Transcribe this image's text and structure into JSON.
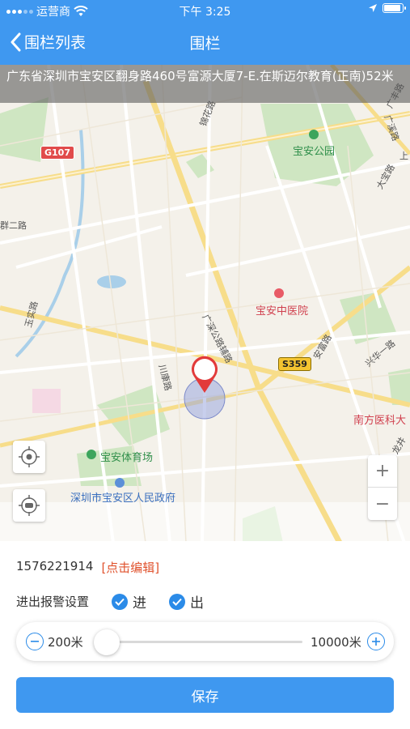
{
  "status_bar": {
    "carrier": "运营商",
    "time": "下午 3:25"
  },
  "nav": {
    "back_label": "围栏列表",
    "title": "围栏"
  },
  "map": {
    "address": "广东省深圳市宝安区翻身路460号富源大厦7-E.在斯迈尔教育(正南)52米",
    "labels": {
      "baoan_park": "宝安公园",
      "baoan_hospital": "宝安中医院",
      "stadium": "宝安体育场",
      "gov": "深圳市宝安区人民政府",
      "south_med": "南方医科大",
      "road_jinhua": "锦花路",
      "road_guangshen": "广深公路辅路",
      "road_chuankang": "川康路",
      "road_anfu": "安富路",
      "road_guangkuan": "广溪路",
      "road_dabao": "大宝路",
      "road_guangfeng": "广丰路",
      "road_qun": "群二路",
      "road_yu": "玉实路",
      "road_xing": "兴华一路",
      "road_long": "龙井",
      "road_shang": "上"
    },
    "road_tags": {
      "g107": "G107",
      "s359": "S359"
    },
    "zoom_in": "+",
    "zoom_out": "−"
  },
  "panel": {
    "phone": "1576221914",
    "edit_label": "[点击编辑]",
    "alarm_label": "进出报警设置",
    "check_in_label": "进",
    "check_out_label": "出",
    "range_min": "200米",
    "range_max": "10000米",
    "save_label": "保存"
  },
  "colors": {
    "accent": "#3f98f0",
    "check": "#2b8be8",
    "edit": "#e0522d"
  }
}
